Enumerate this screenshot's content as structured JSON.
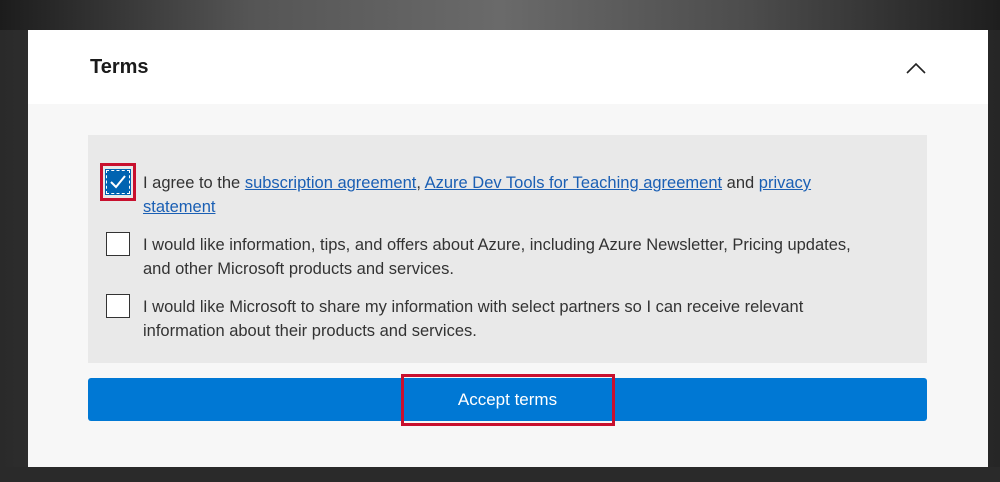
{
  "terms": {
    "title": "Terms",
    "collapse_icon": "chevron-up-icon"
  },
  "options": [
    {
      "checked": true,
      "prefix": "I agree to the ",
      "link1": "subscription agreement",
      "sep1": ", ",
      "link2": "Azure Dev Tools for Teaching agreement",
      "sep2": " and ",
      "link3": "privacy statement"
    },
    {
      "checked": false,
      "text": "I would like information, tips, and offers about Azure, including Azure Newsletter, Pricing updates, and other Microsoft products and services."
    },
    {
      "checked": false,
      "text": "I would like Microsoft to share my information with select partners so I can receive relevant information about their products and services."
    }
  ],
  "accept_button": {
    "label": "Accept terms"
  },
  "colors": {
    "accent": "#0078d4",
    "highlight": "#c8102e",
    "link": "#1a5fb4"
  }
}
